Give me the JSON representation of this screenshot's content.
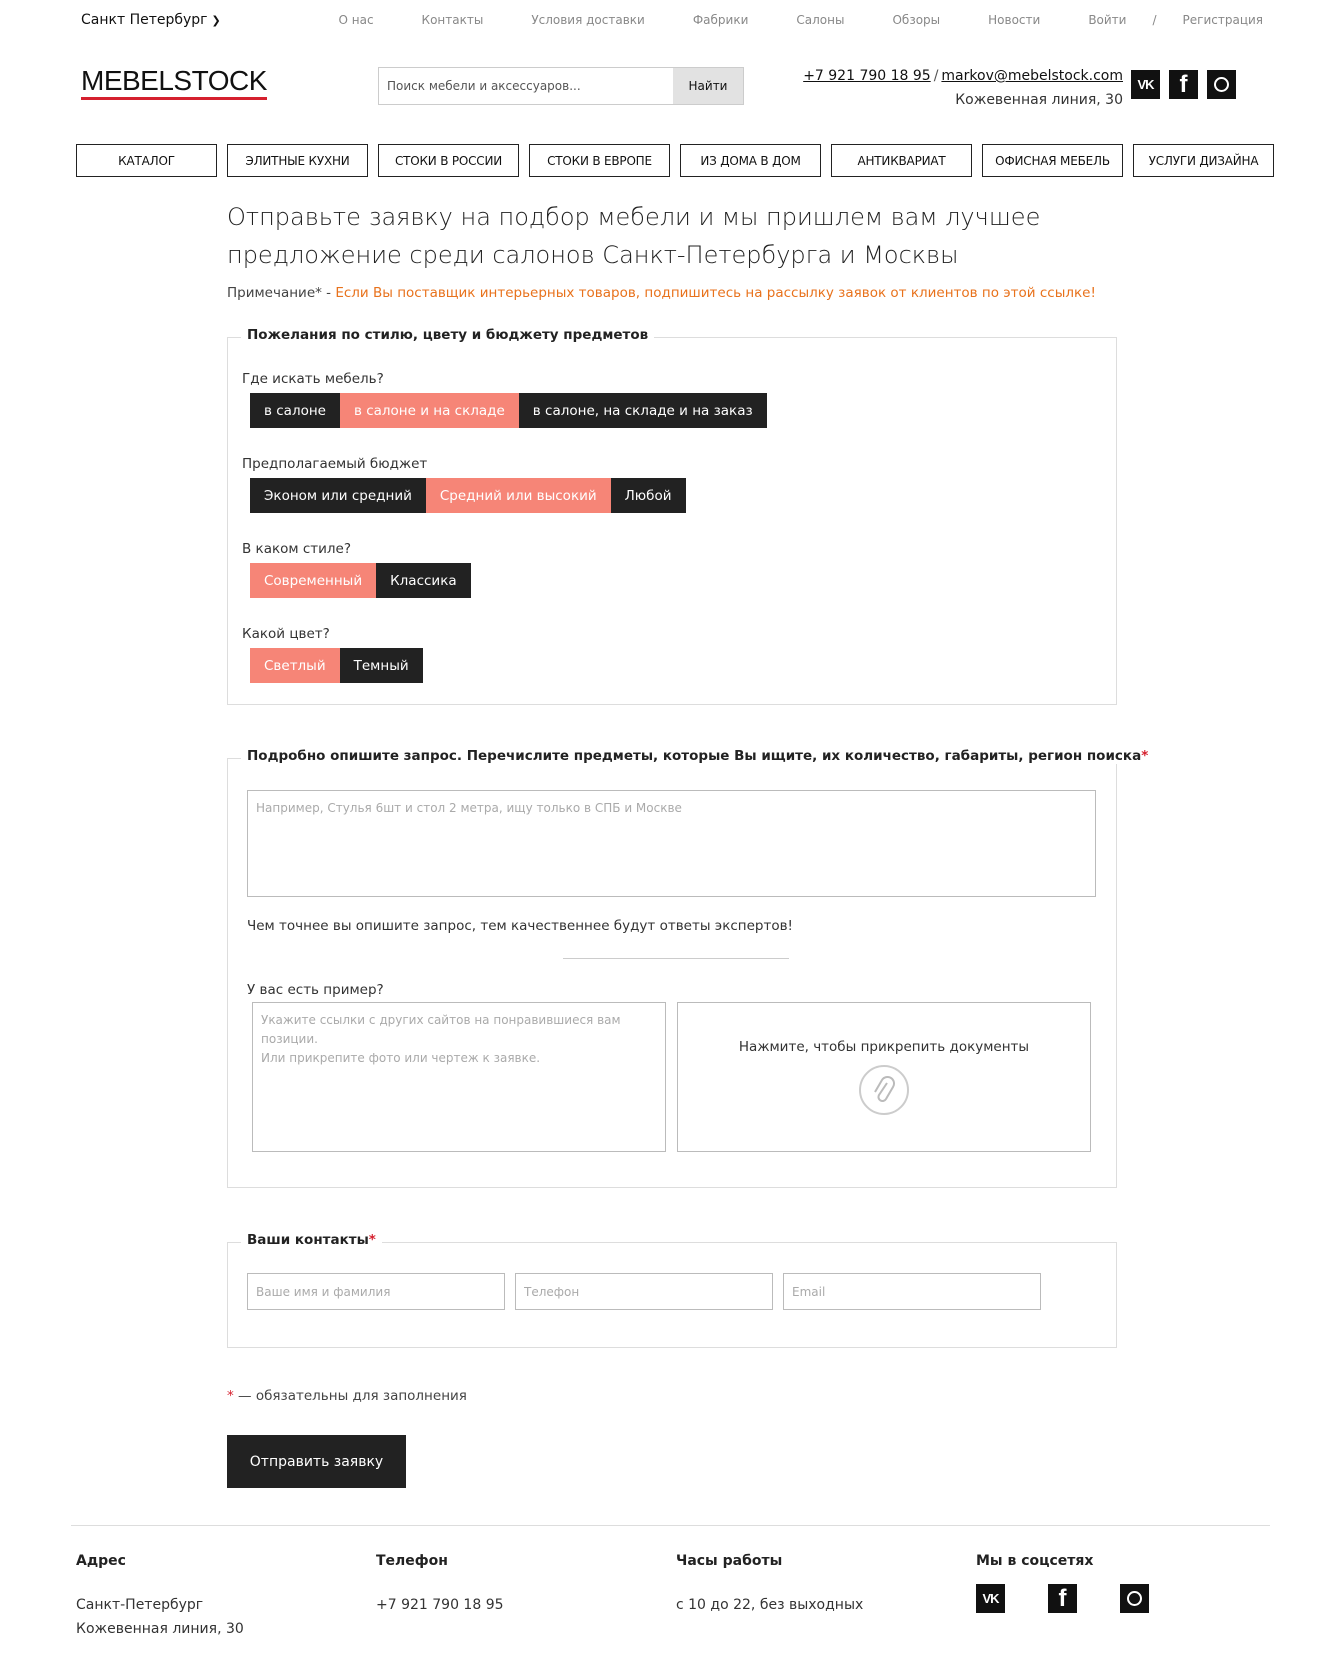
{
  "top": {
    "city": "Санкт Петербург",
    "nav": [
      "О нас",
      "Контакты",
      "Условия доставки",
      "Фабрики",
      "Салоны",
      "Обзоры",
      "Новости"
    ],
    "login": "Войти",
    "sep": "/",
    "register": "Регистрация"
  },
  "header": {
    "logo": "MEBELSTOCK",
    "search_placeholder": "Поиск мебели и аксессуаров...",
    "search_button": "Найти",
    "phone": "+7 921 790 18 95",
    "slash": "/",
    "email": "markov@mebelstock.com",
    "address": "Кожевенная линия, 30"
  },
  "mainnav": [
    "КАТАЛОГ",
    "ЭЛИТНЫЕ КУХНИ",
    "СТОКИ В РОССИИ",
    "СТОКИ В ЕВРОПЕ",
    "ИЗ ДОМА В ДОМ",
    "АНТИКВАРИАТ",
    "ОФИСНАЯ МЕБЕЛЬ",
    "УСЛУГИ ДИЗАЙНА"
  ],
  "headline": "Отправьте заявку на подбор мебели и мы пришлем вам лучшее предложение среди салонов Санкт-Петербурга и Москвы",
  "note": {
    "prefix": "Примечание* - ",
    "link": "Если Вы поставщик интерьерных товаров, подпишитесь на рассылку заявок от клиентов по этой ссылке!"
  },
  "prefs": {
    "legend": "Пожелания по стилю, цвету и бюджету предметов",
    "where": {
      "label": "Где искать мебель?",
      "options": [
        "в салоне",
        "в салоне и на складе",
        "в салоне, на складе и на заказ"
      ],
      "selected": 1
    },
    "budget": {
      "label": "Предполагаемый бюджет",
      "options": [
        "Эконом или средний",
        "Средний или высокий",
        "Любой"
      ],
      "selected": 1
    },
    "style": {
      "label": "В каком стиле?",
      "options": [
        "Современный",
        "Классика"
      ],
      "selected": 0
    },
    "color": {
      "label": "Какой цвет?",
      "options": [
        "Светлый",
        "Темный"
      ],
      "selected": 0
    }
  },
  "request": {
    "legend": "Подробно опишите запрос. Перечислите предметы, которые Вы ищите, их количество, габариты, регион поиска",
    "req": "*",
    "placeholder": "Например, Стулья 6шт и стол 2 метра, ищу только в СПБ и Москве",
    "hint": "Чем точнее вы опишите запрос, тем качественнее будут ответы экспертов!",
    "example_label": "У вас есть пример?",
    "example_placeholder": "Укажите ссылки с других сайтов на понравившиеся вам позиции.\nИли прикрепите фото или чертеж к заявке.",
    "upload_text": "Нажмите, чтобы прикрепить документы"
  },
  "contacts_form": {
    "legend": "Ваши контакты",
    "req": "*",
    "name_placeholder": "Ваше имя и фамилия",
    "phone_placeholder": "Телефон",
    "email_placeholder": "Email"
  },
  "required_note": {
    "star": "*",
    "text": " — обязательны для заполнения"
  },
  "submit": "Отправить заявку",
  "footer": {
    "address_h": "Адрес",
    "address_1": "Санкт-Петербург",
    "address_2": "Кожевенная линия, 30",
    "phone_h": "Телефон",
    "phone": "+7 921 790 18 95",
    "hours_h": "Часы работы",
    "hours": "с 10 до 22, без выходных",
    "social_h": "Мы в соцсетях"
  },
  "colors": {
    "accent": "#f68577",
    "dark": "#222222",
    "link_orange": "#e8721c",
    "logo_red": "#d5202e"
  }
}
